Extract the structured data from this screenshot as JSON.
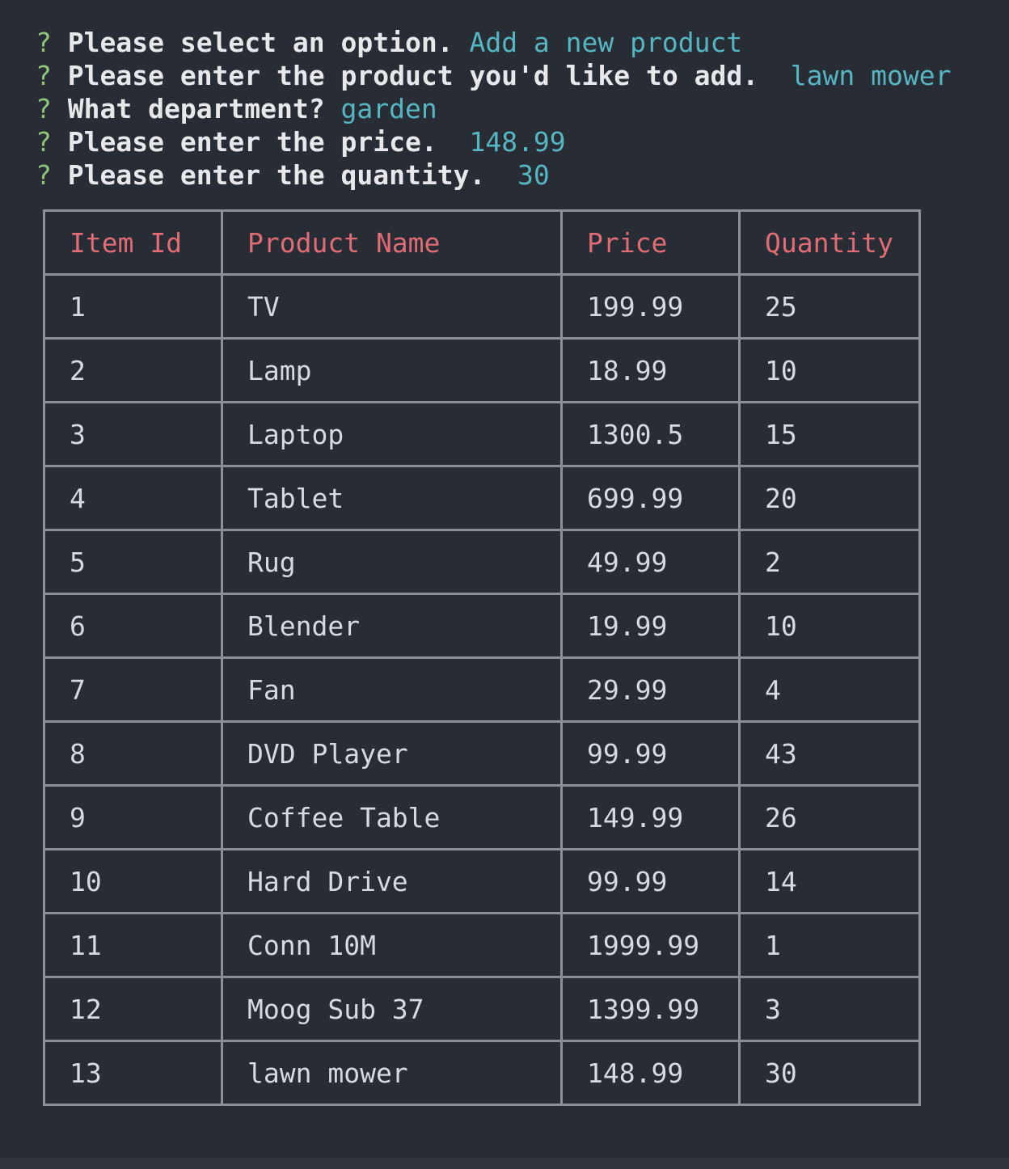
{
  "colors": {
    "background": "#282c34",
    "prompt_marker": "#8fc47a",
    "answer": "#56b6c2",
    "table_header": "#e06c75",
    "table_border": "#8a8f98"
  },
  "prompts": [
    {
      "marker": "?",
      "question": "Please select an option.",
      "answer": "Add a new product"
    },
    {
      "marker": "?",
      "question": "Please enter the product you'd like to add.",
      "answer": " lawn mower"
    },
    {
      "marker": "?",
      "question": "What department?",
      "answer": "garden"
    },
    {
      "marker": "?",
      "question": "Please enter the price.",
      "answer": " 148.99"
    },
    {
      "marker": "?",
      "question": "Please enter the quantity.",
      "answer": " 30"
    }
  ],
  "table": {
    "columns": [
      "Item Id",
      "Product Name",
      "Price",
      "Quantity"
    ],
    "rows": [
      [
        "1",
        "TV",
        "199.99",
        "25"
      ],
      [
        "2",
        "Lamp",
        "18.99",
        "10"
      ],
      [
        "3",
        "Laptop",
        "1300.5",
        "15"
      ],
      [
        "4",
        "Tablet",
        "699.99",
        "20"
      ],
      [
        "5",
        "Rug",
        "49.99",
        "2"
      ],
      [
        "6",
        "Blender",
        "19.99",
        "10"
      ],
      [
        "7",
        "Fan",
        "29.99",
        "4"
      ],
      [
        "8",
        "DVD Player",
        "99.99",
        "43"
      ],
      [
        "9",
        "Coffee Table",
        "149.99",
        "26"
      ],
      [
        "10",
        "Hard Drive",
        "99.99",
        "14"
      ],
      [
        "11",
        "Conn 10M",
        "1999.99",
        "1"
      ],
      [
        "12",
        "Moog Sub 37",
        "1399.99",
        "3"
      ],
      [
        "13",
        "lawn mower",
        "148.99",
        "30"
      ]
    ]
  }
}
